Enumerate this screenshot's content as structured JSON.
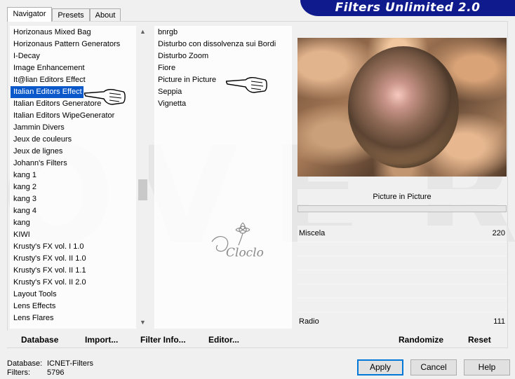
{
  "banner": {
    "title": "Filters Unlimited 2.0"
  },
  "tabs": [
    {
      "label": "Navigator"
    },
    {
      "label": "Presets"
    },
    {
      "label": "About"
    }
  ],
  "categories": {
    "items": [
      "Horizonaus Mixed Bag",
      "Horizonaus Pattern Generators",
      "I-Decay",
      "Image Enhancement",
      "It@lian Editors Effect",
      "Italian Editors Effect",
      "Italian Editors Generatore",
      "Italian Editors WipeGenerator",
      "Jammin Divers",
      "Jeux de couleurs",
      "Jeux de lignes",
      "Johann's Filters",
      "kang 1",
      "kang 2",
      "kang 3",
      "kang 4",
      "kang",
      "KIWI",
      "Krusty's FX vol. I 1.0",
      "Krusty's FX vol. II 1.0",
      "Krusty's FX vol. II 1.1",
      "Krusty's FX vol. II 2.0",
      "Layout Tools",
      "Lens Effects",
      "Lens Flares"
    ],
    "selected_index": 5,
    "scroll_position": 0.55
  },
  "filters": {
    "items": [
      "bnrgb",
      "Disturbo con dissolvenza sui Bordi",
      "Disturbo Zoom",
      "Fiore",
      "Picture in Picture",
      "Seppia",
      "Vignetta"
    ],
    "pointed_index": 4
  },
  "watermark": {
    "letters": [
      "O",
      "V",
      "E",
      "R"
    ],
    "signature": "Cloclo"
  },
  "preview": {
    "filter_name": "Picture in Picture",
    "params": [
      {
        "name": "Miscela",
        "value": "220",
        "level": 0.863
      },
      {
        "name": "Radio",
        "value": "111",
        "level": 0.435
      }
    ]
  },
  "buttons": {
    "database": "Database",
    "import": "Import...",
    "filter_info": "Filter Info...",
    "editor": "Editor...",
    "randomize": "Randomize",
    "reset": "Reset",
    "apply": "Apply",
    "cancel": "Cancel",
    "help": "Help"
  },
  "status": {
    "database_label": "Database:",
    "database_value": "ICNET-Filters",
    "filters_label": "Filters:",
    "filters_value": "5796"
  },
  "colors": {
    "banner": "#0f1a8c",
    "selection": "#0a58ca",
    "default_button_border": "#0078d7"
  }
}
